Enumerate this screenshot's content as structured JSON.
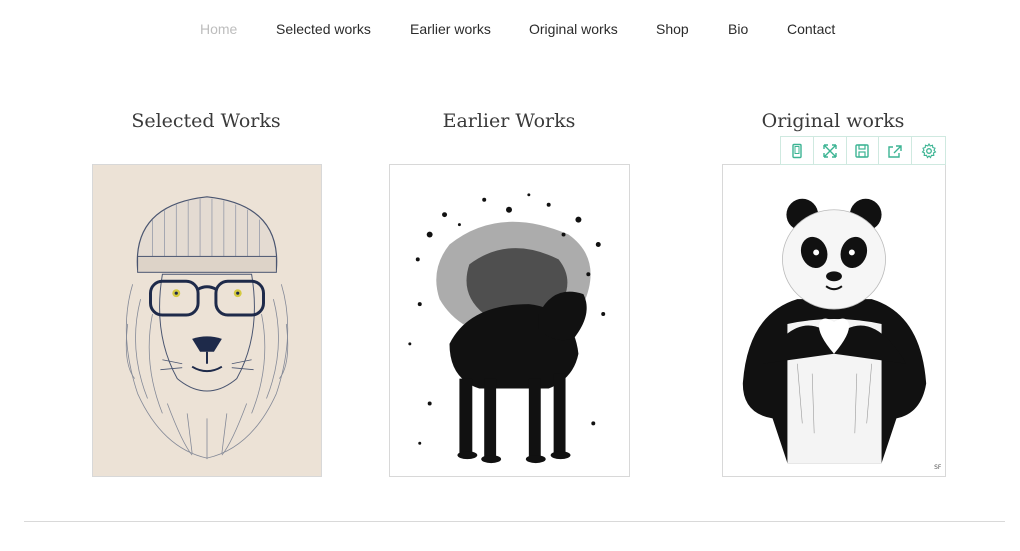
{
  "nav": {
    "items": [
      "Home",
      "Selected works",
      "Earlier works",
      "Original works",
      "Shop",
      "Bio",
      "Contact"
    ],
    "active": "Home"
  },
  "gallery": {
    "columns": [
      {
        "title": "Selected Works",
        "image": "lion-with-beanie-and-glasses"
      },
      {
        "title": "Earlier Works",
        "image": "ink-splatter-wolf"
      },
      {
        "title": "Original works",
        "image": "panda-heart-hands"
      }
    ]
  },
  "toolbar": {
    "icons": [
      "mobile-icon",
      "expand-icon",
      "save-icon",
      "share-icon",
      "settings-icon"
    ],
    "accent": "#3cb493"
  },
  "colors": {
    "text": "#2b2b2b",
    "active_nav": "#bdbdbd",
    "lion_background": "#efe5da"
  }
}
